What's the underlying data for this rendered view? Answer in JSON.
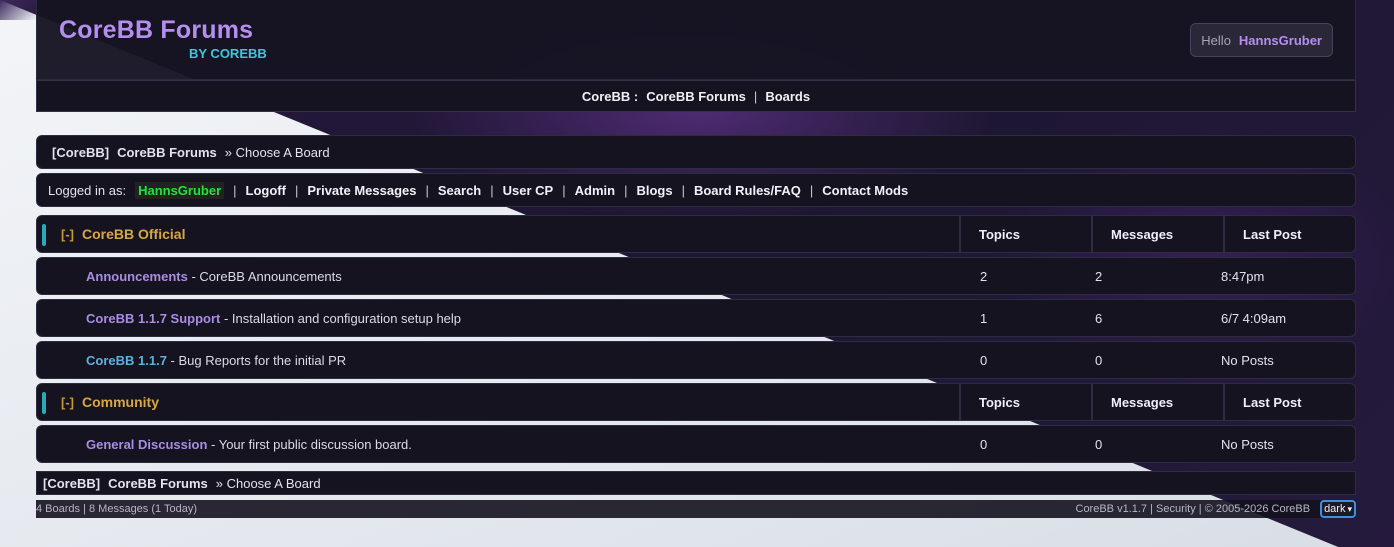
{
  "header": {
    "title": "CoreBB Forums",
    "subtitle": "BY COREBB",
    "hello_label": "Hello",
    "hello_user": "HannsGruber"
  },
  "navbar": {
    "items": [
      "CoreBB :",
      "CoreBB Forums",
      "Boards"
    ],
    "separator": "|"
  },
  "breadcrumb": {
    "root": "[CoreBB]",
    "forum": "CoreBB Forums",
    "current": "» Choose A Board"
  },
  "loginbar": {
    "label": "Logged in as:",
    "user": "HannsGruber",
    "links": [
      "Logoff",
      "Private Messages",
      "Search",
      "User CP",
      "Admin",
      "Blogs",
      "Board Rules/FAQ",
      "Contact Mods"
    ],
    "separator": "|"
  },
  "columns": {
    "topics": "Topics",
    "messages": "Messages",
    "last_post": "Last Post"
  },
  "categories": [
    {
      "toggle": "[-]",
      "name": "CoreBB Official",
      "boards": [
        {
          "name": "Announcements",
          "desc": "- CoreBB Announcements",
          "topics": "2",
          "messages": "2",
          "last": "8:47pm"
        },
        {
          "name": "CoreBB 1.1.7 Support",
          "desc": "- Installation and configuration setup help",
          "topics": "1",
          "messages": "6",
          "last": "6/7 4:09am"
        },
        {
          "name": "CoreBB 1.1.7",
          "desc": "- Bug Reports for the initial PR",
          "topics": "0",
          "messages": "0",
          "last": "No Posts"
        }
      ]
    },
    {
      "toggle": "[-]",
      "name": "Community",
      "boards": [
        {
          "name": "General Discussion",
          "desc": "- Your first public discussion board.",
          "topics": "0",
          "messages": "0",
          "last": "No Posts"
        }
      ]
    }
  ],
  "footer": {
    "stats": "4 Boards | 8 Messages (1 Today)",
    "credits": "CoreBB v1.1.7 | Security | © 2005-2026 CoreBB",
    "theme": "dark"
  },
  "colors": {
    "accent_purple": "#b58ef0",
    "accent_cyan": "#3fc7d9",
    "category_gold": "#d8a645",
    "online_green": "#25e23a"
  }
}
